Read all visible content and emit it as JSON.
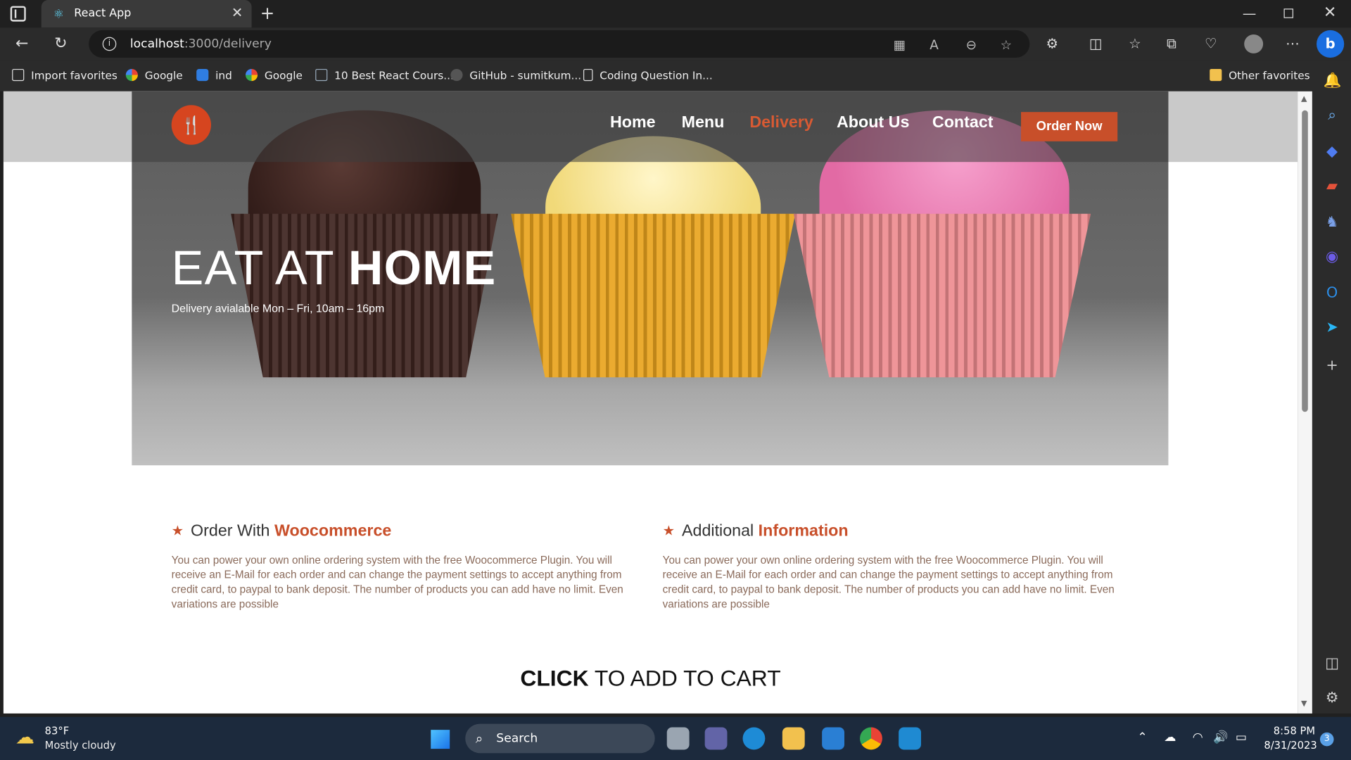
{
  "browser": {
    "tab_title": "React App",
    "url_host": "localhost",
    "url_path": ":3000/delivery",
    "favorites": [
      {
        "label": "Import favorites"
      },
      {
        "label": "Google"
      },
      {
        "label": "ind"
      },
      {
        "label": "Google"
      },
      {
        "label": "10 Best React Cours..."
      },
      {
        "label": "GitHub - sumitkum..."
      },
      {
        "label": "Coding Question In..."
      }
    ],
    "other_favorites": "Other favorites"
  },
  "site": {
    "nav": [
      {
        "label": "Home",
        "active": false
      },
      {
        "label": "Menu",
        "active": false
      },
      {
        "label": "Delivery",
        "active": true
      },
      {
        "label": "About Us",
        "active": false
      },
      {
        "label": "Contact",
        "active": false
      }
    ],
    "order_button": "Order Now",
    "hero": {
      "title_light": "EAT AT ",
      "title_bold": "HOME",
      "subtitle": "Delivery avialable Mon – Fri, 10am – 16pm"
    },
    "sections": [
      {
        "title_light": "Order With ",
        "title_bold": "Woocommerce",
        "text": "You can power your own online ordering system with the free Woocommerce Plugin. You will receive an E-Mail for each order and can change the payment settings to accept anything from credit card, to paypal to bank deposit. The number of products you can add have no limit. Even variations are possible"
      },
      {
        "title_light": "Additional ",
        "title_bold": "Information",
        "text": "You can power your own online ordering system with the free Woocommerce Plugin. You will receive an E-Mail for each order and can change the payment settings to accept anything from credit card, to paypal to bank deposit. The number of products you can add have no limit. Even variations are possible"
      }
    ],
    "cta_bold": "CLICK",
    "cta_rest": " TO ADD TO CART",
    "accent_color": "#c84f2a"
  },
  "taskbar": {
    "temp": "83°F",
    "weather": "Mostly cloudy",
    "search": "Search",
    "time": "8:58 PM",
    "date": "8/31/2023",
    "notifications": "3"
  }
}
